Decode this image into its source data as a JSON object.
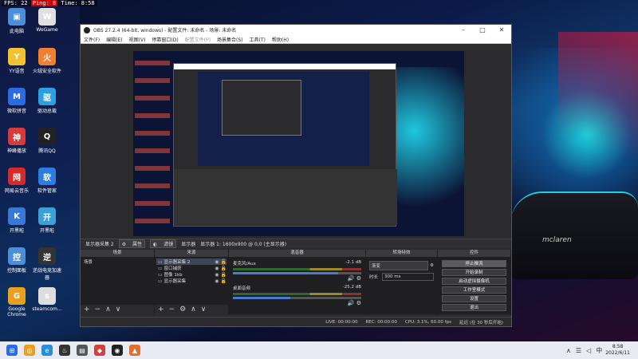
{
  "overlay": {
    "fps": "FPS: 22",
    "ping": "Ping: 8",
    "time": "Time: 8:58"
  },
  "desktop_icons": [
    {
      "label": "此电脑",
      "color": "#4a8fd8",
      "glyph": "▣"
    },
    {
      "label": "WeGame",
      "color": "#e0e0e0",
      "glyph": "W"
    },
    {
      "label": "YY语音",
      "color": "#f1c232",
      "glyph": "Y"
    },
    {
      "label": "火绒安全软件",
      "color": "#f08030",
      "glyph": "火"
    },
    {
      "label": "微软拼音",
      "color": "#2b6de0",
      "glyph": "M"
    },
    {
      "label": "驱动总裁",
      "color": "#2aa0e0",
      "glyph": "驱"
    },
    {
      "label": "神峰播放",
      "color": "#d83a3a",
      "glyph": "神"
    },
    {
      "label": "腾讯QQ",
      "color": "#222",
      "glyph": "Q"
    },
    {
      "label": "网易云音乐",
      "color": "#d42a2a",
      "glyph": "网"
    },
    {
      "label": "软件管家",
      "color": "#2b7de0",
      "glyph": "软"
    },
    {
      "label": "开黑啦",
      "color": "#3a78d8",
      "glyph": "K"
    },
    {
      "label": "开黑啦",
      "color": "#3aa0d8",
      "glyph": "开"
    },
    {
      "label": "控制面板",
      "color": "#4a8fd8",
      "glyph": "控"
    },
    {
      "label": "逆战电竞加速器",
      "color": "#333",
      "glyph": "逆"
    },
    {
      "label": "Google Chrome",
      "color": "#e8a020",
      "glyph": "G"
    },
    {
      "label": "steamcom...",
      "color": "#ddd",
      "glyph": "s"
    }
  ],
  "obs": {
    "title": "OBS 27.2.4 (64-bit, windows) - 配置文件: 未命名 - 场景: 未命名",
    "menu": [
      "文件(F)",
      "编辑(E)",
      "视图(V)",
      "停靠窗口(D)",
      "配置文件(P)",
      "场景集合(S)",
      "工具(T)",
      "帮助(H)"
    ],
    "menu_dim_index": 4,
    "status_row": {
      "source_name": "显示器采集 2",
      "properties": "属性",
      "filters": "滤镜",
      "display_label": "显示器",
      "display_value": "显示器 1: 1600x900 @ 0,0 (主显示器)"
    },
    "panels": {
      "scenes": {
        "title": "场景",
        "items": [
          "场景"
        ]
      },
      "sources": {
        "title": "来源",
        "items": [
          "显示器采集 2",
          "窗口捕获",
          "图像 1kb",
          "显示器采集"
        ]
      },
      "mixer": {
        "title": "混音器",
        "channels": [
          {
            "name": "麦克风/Aux",
            "db": "-2.1 dB",
            "level": 0.82
          },
          {
            "name": "桌面音频",
            "db": "-25.2 dB",
            "level": 0.45
          }
        ]
      },
      "transitions": {
        "title": "转场特效",
        "selected": "渐变",
        "duration_label": "时长",
        "duration_value": "300 ms"
      },
      "controls": {
        "title": "控件",
        "buttons": [
          "停止推流",
          "开始录制",
          "启动虚拟摄像机",
          "工作室模式",
          "设置",
          "退出"
        ]
      }
    },
    "statusbar": {
      "live": "LIVE: 00:00:00",
      "rec": "REC: 00:00:00",
      "cpu": "CPU: 3.1%, 60.00 fps",
      "delay": "延迟 (在 30 秒后开始)"
    }
  },
  "taskbar": {
    "clock_time": "8:58",
    "clock_date": "2022/6/11"
  },
  "wallpaper_brand": "mclaren"
}
